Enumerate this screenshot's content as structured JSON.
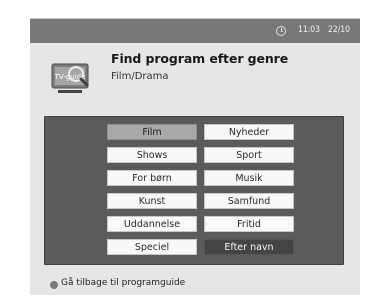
{
  "status": {
    "time": "11:03",
    "date": "22/10"
  },
  "header": {
    "logo_text": "TV-guide",
    "title": "Find program efter genre",
    "subtitle": "Film/Drama"
  },
  "genres": {
    "col1": [
      "Film",
      "Shows",
      "For børn",
      "Kunst",
      "Uddannelse",
      "Speciel"
    ],
    "col2": [
      "Nyheder",
      "Sport",
      "Musik",
      "Samfund",
      "Fritid",
      "Efter navn"
    ]
  },
  "footer": {
    "back_label": "Gå tilbage til programguide"
  },
  "colors": {
    "selected": "#a9a9a9",
    "panel": "#5b5b5b",
    "statusbar": "#787878",
    "alt_button": "#444444"
  }
}
